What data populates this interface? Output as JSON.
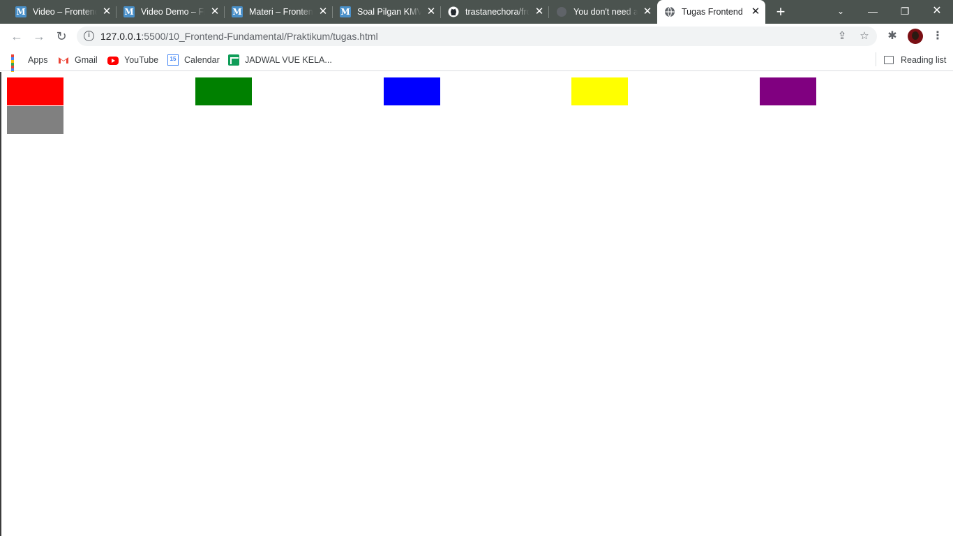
{
  "tabs": [
    {
      "title": "Video – Frontend",
      "favicon": "m-icon"
    },
    {
      "title": "Video Demo – Frontend",
      "favicon": "m-icon"
    },
    {
      "title": "Materi – Frontend",
      "favicon": "m-icon"
    },
    {
      "title": "Soal Pilgan KMVue",
      "favicon": "m-icon"
    },
    {
      "title": "trastanechora/frontend",
      "favicon": "github-icon"
    },
    {
      "title": "You don't need a",
      "favicon": "globe-icon"
    },
    {
      "title": "Tugas Frontend",
      "favicon": "globe-icon",
      "active": true
    }
  ],
  "address_bar": {
    "host": "127.0.0.1",
    "path": ":5500/10_Frontend-Fundamental/Praktikum/tugas.html"
  },
  "bookmarks": [
    {
      "label": "Apps",
      "icon": "apps-grid-icon"
    },
    {
      "label": "Gmail",
      "icon": "gmail-icon"
    },
    {
      "label": "YouTube",
      "icon": "youtube-icon"
    },
    {
      "label": "Calendar",
      "icon": "calendar-icon",
      "icon_text": "15"
    },
    {
      "label": "JADWAL VUE KELA...",
      "icon": "sheets-icon"
    }
  ],
  "reading_list": {
    "label": "Reading list"
  },
  "page": {
    "boxes": [
      {
        "name": "red-box",
        "color": "#ff0000"
      },
      {
        "name": "green-box",
        "color": "#008000"
      },
      {
        "name": "blue-box",
        "color": "#0000ff"
      },
      {
        "name": "yellow-box",
        "color": "#ffff00"
      },
      {
        "name": "purple-box",
        "color": "#800080"
      },
      {
        "name": "gray-box",
        "color": "#808080"
      }
    ]
  }
}
